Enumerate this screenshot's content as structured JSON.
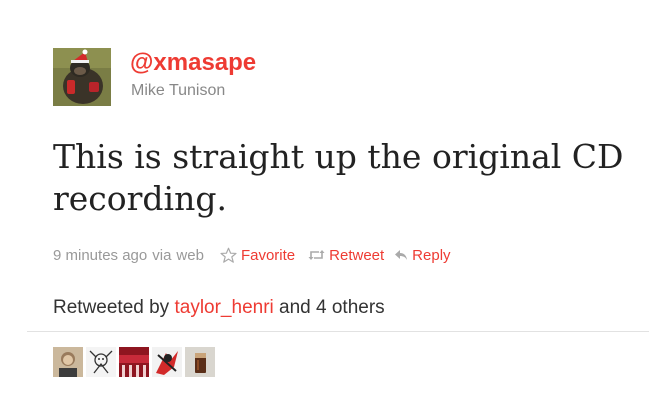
{
  "tweet": {
    "screen_name": "@xmasape",
    "full_name": "Mike Tunison",
    "text": "This is straight up the original CD recording."
  },
  "meta": {
    "timestamp": "9 minutes ago",
    "via": "via",
    "source": "web",
    "actions": [
      {
        "label": "Favorite",
        "icon": "star-icon"
      },
      {
        "label": "Retweet",
        "icon": "retweet-icon"
      },
      {
        "label": "Reply",
        "icon": "reply-icon"
      }
    ]
  },
  "retweeted": {
    "prefix": "Retweeted by",
    "user": "taylor_henri",
    "suffix": "and 4 others"
  },
  "retweeters": [
    {
      "icon": "avatar-person"
    },
    {
      "icon": "avatar-sketch"
    },
    {
      "icon": "avatar-red-stage"
    },
    {
      "icon": "avatar-cartoon"
    },
    {
      "icon": "avatar-drink"
    }
  ],
  "colors": {
    "link": "#ee3b33",
    "muted": "#999999",
    "text": "#222222"
  }
}
